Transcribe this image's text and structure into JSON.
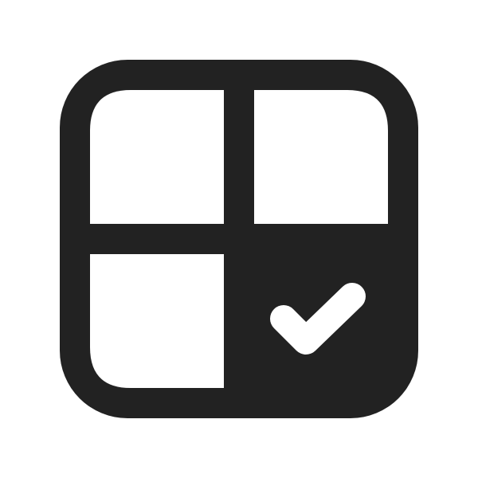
{
  "icon": {
    "name": "grid-with-checkmark-icon",
    "colors": {
      "foreground": "#222222",
      "background": "#ffffff",
      "check": "#ffffff"
    },
    "cells": [
      {
        "position": "top-left",
        "state": "empty"
      },
      {
        "position": "top-right",
        "state": "empty"
      },
      {
        "position": "bottom-left",
        "state": "empty"
      },
      {
        "position": "bottom-right",
        "state": "checked"
      }
    ]
  }
}
